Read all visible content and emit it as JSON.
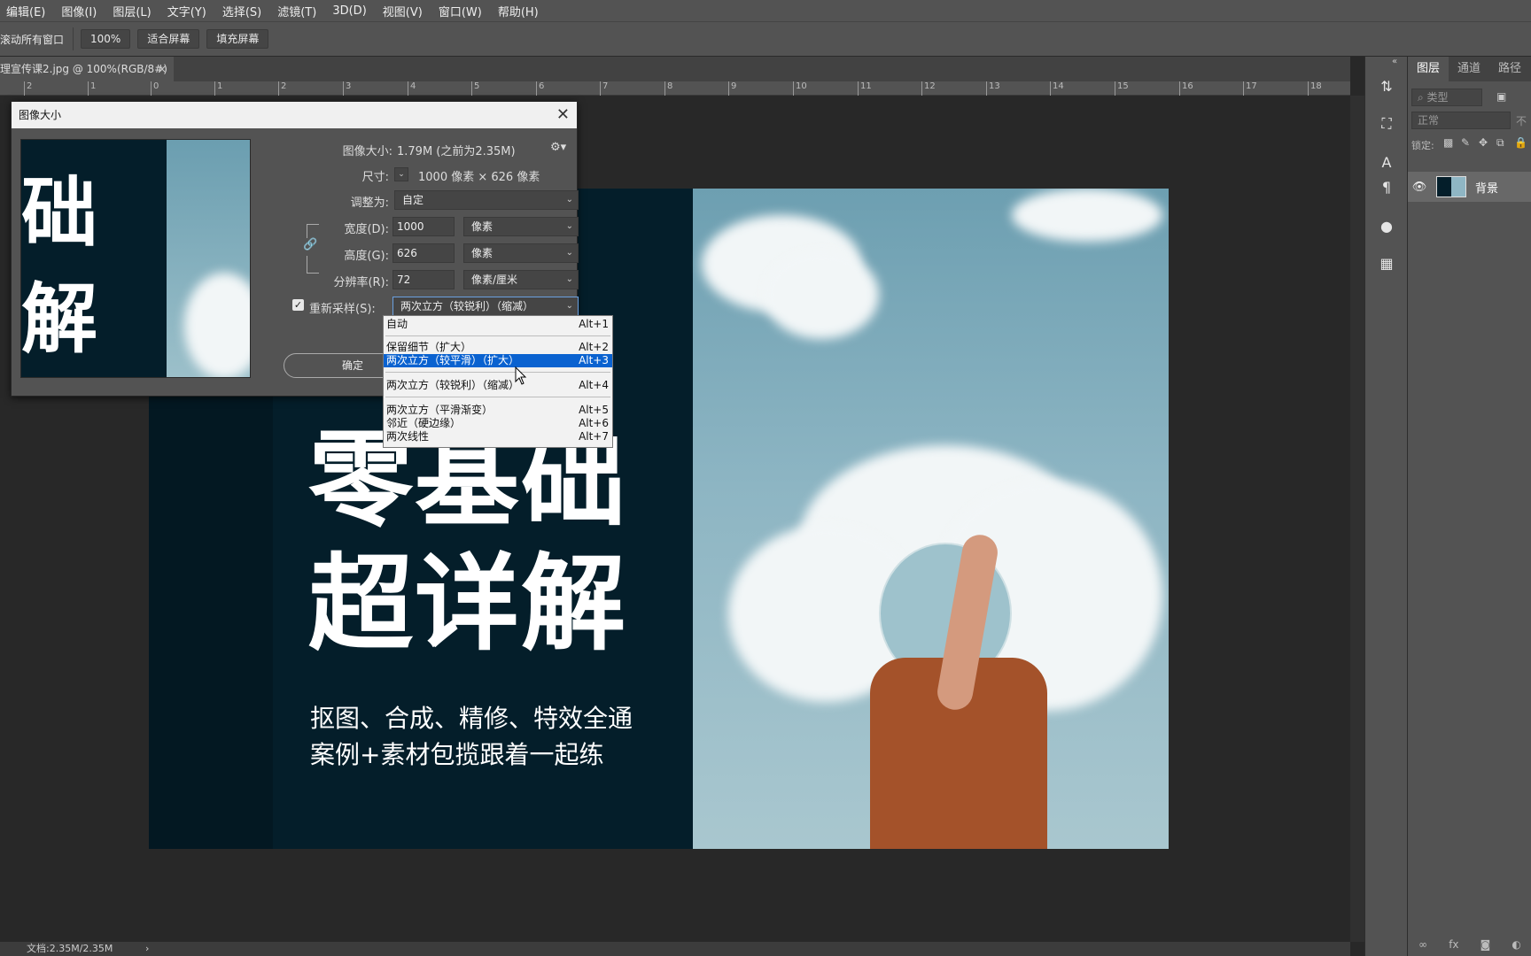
{
  "menubar": {
    "items": [
      "编辑(E)",
      "图像(I)",
      "图层(L)",
      "文字(Y)",
      "选择(S)",
      "滤镜(T)",
      "3D(D)",
      "视图(V)",
      "窗口(W)",
      "帮助(H)"
    ]
  },
  "options": {
    "scroll_all_label": "滚动所有窗口",
    "zoom_label": "100%",
    "fit_screen_label": "适合屏幕",
    "fill_screen_label": "填充屏幕"
  },
  "document_tab": {
    "title": "理宣传课2.jpg @ 100%(RGB/8#)",
    "close": "×"
  },
  "ruler": {
    "ticks": [
      "2",
      "1",
      "0",
      "1",
      "2",
      "3",
      "4",
      "5",
      "6",
      "7",
      "8",
      "9",
      "10",
      "11",
      "12",
      "13",
      "14",
      "15",
      "16",
      "17",
      "18"
    ]
  },
  "artwork": {
    "headline_1": "零基础",
    "headline_2": "超详解",
    "subline_1": "抠图、合成、精修、特效全通",
    "subline_2": "案例+素材包揽跟着一起练"
  },
  "preview": {
    "char_1": "础",
    "char_2": "解"
  },
  "dialog": {
    "title": "图像大小",
    "close": "✕",
    "image_size_label": "图像大小:",
    "image_size_value": "1.79M (之前为2.35M)",
    "dimensions_label": "尺寸:",
    "dimensions_value": "1000 像素 × 626 像素",
    "fit_to_label": "调整为:",
    "fit_to_value": "自定",
    "width_label": "宽度(D):",
    "width_value": "1000",
    "width_unit": "像素",
    "height_label": "高度(G):",
    "height_value": "626",
    "height_unit": "像素",
    "resolution_label": "分辨率(R):",
    "resolution_value": "72",
    "resolution_unit": "像素/厘米",
    "resample_label": "重新采样(S):",
    "resample_checked": true,
    "resample_value": "两次立方（较锐利）（缩减）",
    "ok_label": "确定"
  },
  "resample_menu": [
    {
      "label": "自动",
      "key": "Alt+1",
      "selected": false
    },
    {
      "label": "保留细节（扩大）",
      "key": "Alt+2",
      "selected": false
    },
    {
      "label": "两次立方（较平滑）（扩大）",
      "key": "Alt+3",
      "selected": true
    },
    {
      "label": "两次立方（较锐利）（缩减）",
      "key": "Alt+4",
      "selected": false
    },
    {
      "label": "两次立方（平滑渐变）",
      "key": "Alt+5",
      "selected": false
    },
    {
      "label": "邻近（硬边缘）",
      "key": "Alt+6",
      "selected": false
    },
    {
      "label": "两次线性",
      "key": "Alt+7",
      "selected": false
    }
  ],
  "panel": {
    "tabs": [
      "图层",
      "通道",
      "路径"
    ],
    "search_placeholder": "类型",
    "blend_mode": "正常",
    "opacity_label": "不",
    "lock_label": "锁定:",
    "layer_name": "背景"
  },
  "status": {
    "doc_label": "文档:2.35M/2.35M",
    "arrow": "›"
  }
}
